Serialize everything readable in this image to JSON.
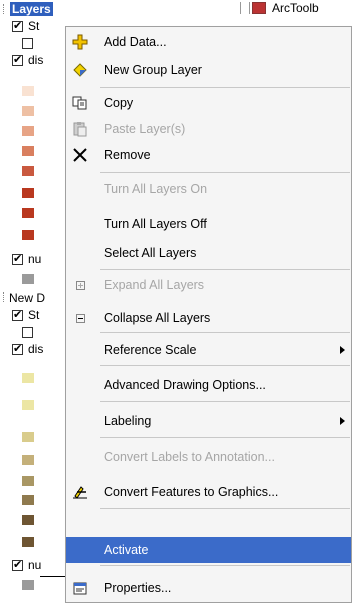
{
  "toc": {
    "layers_title": "Layers",
    "arctoolbox_label": "ArcToolb",
    "new_frame_label": "New D",
    "items": {
      "st1": "St",
      "dis1": "dis",
      "nu1": "nu",
      "st2": "St",
      "dis2": "dis",
      "nu2": "nu"
    },
    "swatches_1": [
      "#f9e2d2",
      "#eec0a4",
      "#e7a486",
      "#d97f5f",
      "#c9593f",
      "#b9381f"
    ],
    "swatch_gray": "#9a9a9a",
    "swatches_2": [
      "#ece6a4",
      "#d9cc8c",
      "#c4b07a",
      "#a99764",
      "#8f7a4e",
      "#6e5532"
    ]
  },
  "menu": {
    "items": [
      {
        "label": "Add Data...",
        "icon": "add-data-icon",
        "enabled": true
      },
      {
        "label": "New Group Layer",
        "icon": "group-layer-icon",
        "enabled": true
      },
      {
        "label": "Copy",
        "icon": "copy-icon",
        "enabled": true
      },
      {
        "label": "Paste Layer(s)",
        "icon": "paste-icon",
        "enabled": false
      },
      {
        "label": "Remove",
        "icon": "remove-icon",
        "enabled": true
      },
      {
        "label": "Turn All Layers On",
        "icon": "",
        "enabled": false
      },
      {
        "label": "Turn All Layers Off",
        "icon": "",
        "enabled": true
      },
      {
        "label": "Select All Layers",
        "icon": "",
        "enabled": true
      },
      {
        "label": "Expand All Layers",
        "icon": "expand-icon",
        "enabled": false
      },
      {
        "label": "Collapse All Layers",
        "icon": "collapse-icon",
        "enabled": true
      },
      {
        "label": "Reference Scale",
        "icon": "",
        "enabled": true,
        "submenu": true
      },
      {
        "label": "Advanced Drawing Options...",
        "icon": "",
        "enabled": true
      },
      {
        "label": "Labeling",
        "icon": "",
        "enabled": true,
        "submenu": true
      },
      {
        "label": "Convert Labels to Annotation...",
        "icon": "",
        "enabled": false
      },
      {
        "label": "Convert Features to Graphics...",
        "icon": "convert-graphics-icon",
        "enabled": true
      },
      {
        "label": "Activate",
        "icon": "",
        "enabled": true,
        "selected": true
      },
      {
        "label": "Properties...",
        "icon": "properties-icon",
        "enabled": true
      }
    ]
  },
  "colors": {
    "selection": "#3b6bc9",
    "disabled_text": "#a6a6a6"
  }
}
